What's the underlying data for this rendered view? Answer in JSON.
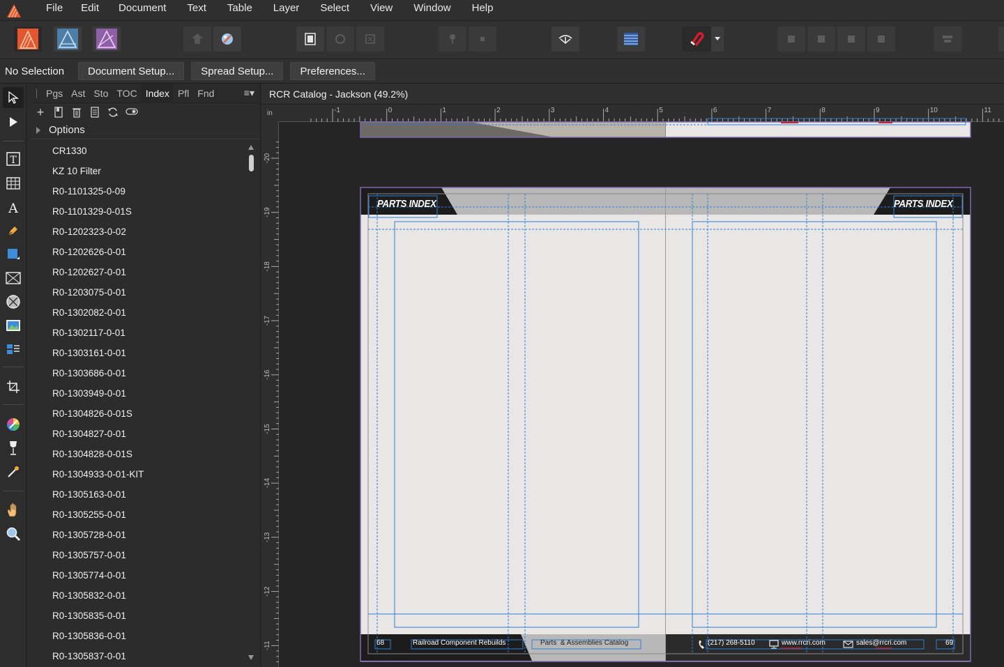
{
  "menu": {
    "items": [
      "File",
      "Edit",
      "Document",
      "Text",
      "Table",
      "Layer",
      "Select",
      "View",
      "Window",
      "Help"
    ]
  },
  "context": {
    "selection_label": "No Selection",
    "buttons": [
      "Document Setup...",
      "Spread Setup...",
      "Preferences..."
    ]
  },
  "panel": {
    "tabs": [
      "Pgs",
      "Ast",
      "Sto",
      "TOC",
      "Index",
      "Pfl",
      "Fnd"
    ],
    "active_tab": "Index",
    "options_label": "Options",
    "items": [
      "CR1330",
      "KZ 10 Filter",
      "R0-1101325-0-09",
      "R0-1101329-0-01S",
      "R0-1202323-0-02",
      "R0-1202626-0-01",
      "R0-1202627-0-01",
      "R0-1203075-0-01",
      "R0-1302082-0-01",
      "R0-1302117-0-01",
      "R0-1303161-0-01",
      "R0-1303686-0-01",
      "R0-1303949-0-01",
      "R0-1304826-0-01S",
      "R0-1304827-0-01",
      "R0-1304828-0-01S",
      "R0-1304933-0-01-KIT",
      "R0-1305163-0-01",
      "R0-1305255-0-01",
      "R0-1305728-0-01",
      "R0-1305757-0-01",
      "R0-1305774-0-01",
      "R0-1305832-0-01",
      "R0-1305835-0-01",
      "R0-1305836-0-01",
      "R0-1305837-0-01"
    ]
  },
  "document": {
    "title": "RCR Catalog - Jackson (49.2%)",
    "ruler_unit": "in",
    "ruler_h_labels": [
      "-1",
      "0",
      "1",
      "2",
      "3",
      "4",
      "5",
      "6",
      "7",
      "8",
      "9",
      "10",
      "11"
    ],
    "ruler_v_labels": [
      "-20",
      "-19",
      "-18",
      "-17",
      "-16",
      "-15",
      "-14",
      "-13",
      "-12",
      "-11"
    ],
    "left_page": {
      "header": "PARTS INDEX",
      "page_number": "68",
      "footer_left": "Railroad Component Rebuilds",
      "footer_right": "Parts  & Assemblies Catalog"
    },
    "right_page": {
      "header": "PARTS INDEX",
      "page_number": "69",
      "phone": "(217) 268-5110",
      "website": "www.rrcri.com",
      "email": "sales@rrcri.com"
    }
  },
  "colors": {
    "accent_blue": "#2f7fd4",
    "header_gray": "#b8b8b8",
    "header_black": "#1c1c1c",
    "page_bg": "#e9e7e6",
    "spread_border": "#7d6ab0",
    "snap_red": "#d41e2f"
  }
}
